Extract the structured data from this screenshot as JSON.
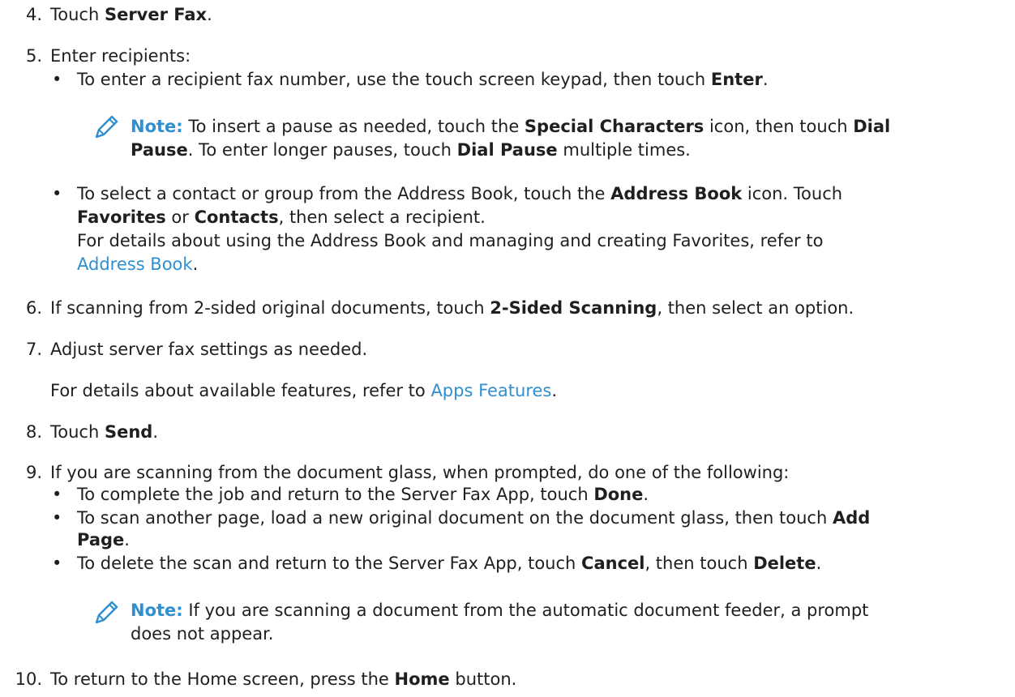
{
  "colors": {
    "text": "#1f1f1f",
    "link": "#2f8fd0",
    "note_label": "#2f8fd0"
  },
  "icons": {
    "note": "pencil-icon"
  },
  "steps": [
    {
      "number": "4.",
      "parts": [
        {
          "t": "Touch "
        },
        {
          "t": "Server Fax",
          "b": true
        },
        {
          "t": "."
        }
      ]
    },
    {
      "number": "5.",
      "parts": [
        {
          "t": "Enter recipients:"
        }
      ]
    },
    {
      "number": "6.",
      "parts": [
        {
          "t": "If scanning from 2-sided original documents, touch "
        },
        {
          "t": "2-Sided Scanning",
          "b": true
        },
        {
          "t": ", then select an option."
        }
      ]
    },
    {
      "number": "7.",
      "parts": [
        {
          "t": "Adjust server fax settings as needed."
        }
      ]
    },
    {
      "number": "8.",
      "parts": [
        {
          "t": "Touch "
        },
        {
          "t": "Send",
          "b": true
        },
        {
          "t": "."
        }
      ]
    },
    {
      "number": "9.",
      "parts": [
        {
          "t": "If you are scanning from the document glass, when prompted, do one of the following:"
        }
      ]
    },
    {
      "number": "10.",
      "parts": [
        {
          "t": "To return to the Home screen, press the "
        },
        {
          "t": "Home",
          "b": true
        },
        {
          "t": " button."
        }
      ]
    }
  ],
  "step5_bullet1": [
    {
      "t": "To enter a recipient fax number, use the touch screen keypad, then touch "
    },
    {
      "t": "Enter",
      "b": true
    },
    {
      "t": "."
    }
  ],
  "note1": {
    "label": "Note:",
    "line1": [
      {
        "t": " To insert a pause as needed, touch the "
      },
      {
        "t": "Special Characters",
        "b": true
      },
      {
        "t": " icon, then touch "
      },
      {
        "t": "Dial",
        "b": true
      }
    ],
    "line2": [
      {
        "t": "Pause",
        "b": true
      },
      {
        "t": ". To enter longer pauses, touch "
      },
      {
        "t": "Dial Pause",
        "b": true
      },
      {
        "t": " multiple times."
      }
    ]
  },
  "step5_bullet2": {
    "line1": [
      {
        "t": "To select a contact or group from the Address Book, touch the "
      },
      {
        "t": "Address Book",
        "b": true
      },
      {
        "t": " icon. Touch"
      }
    ],
    "line2": [
      {
        "t": "Favorites",
        "b": true
      },
      {
        "t": " or "
      },
      {
        "t": "Contacts",
        "b": true
      },
      {
        "t": ", then select a recipient."
      }
    ],
    "line3": [
      {
        "t": "For details about using the Address Book and managing and creating Favorites, refer to"
      }
    ],
    "line4": [
      {
        "t": "Address Book",
        "link": true
      },
      {
        "t": "."
      }
    ]
  },
  "step7_detail": [
    {
      "t": "For details about available features, refer to "
    },
    {
      "t": "Apps Features",
      "link": true
    },
    {
      "t": "."
    }
  ],
  "step9_bullets": {
    "b1": [
      {
        "t": "To complete the job and return to the Server Fax App, touch "
      },
      {
        "t": "Done",
        "b": true
      },
      {
        "t": "."
      }
    ],
    "b2_line1": [
      {
        "t": "To scan another page, load a new original document on the document glass, then touch "
      },
      {
        "t": "Add",
        "b": true
      }
    ],
    "b2_line2": [
      {
        "t": "Page",
        "b": true
      },
      {
        "t": "."
      }
    ],
    "b3": [
      {
        "t": "To delete the scan and return to the Server Fax App, touch "
      },
      {
        "t": "Cancel",
        "b": true
      },
      {
        "t": ", then touch "
      },
      {
        "t": "Delete",
        "b": true
      },
      {
        "t": "."
      }
    ]
  },
  "note2": {
    "label": "Note:",
    "line1": [
      {
        "t": " If you are scanning a document from the automatic document feeder, a prompt"
      }
    ],
    "line2": [
      {
        "t": "does not appear."
      }
    ]
  }
}
